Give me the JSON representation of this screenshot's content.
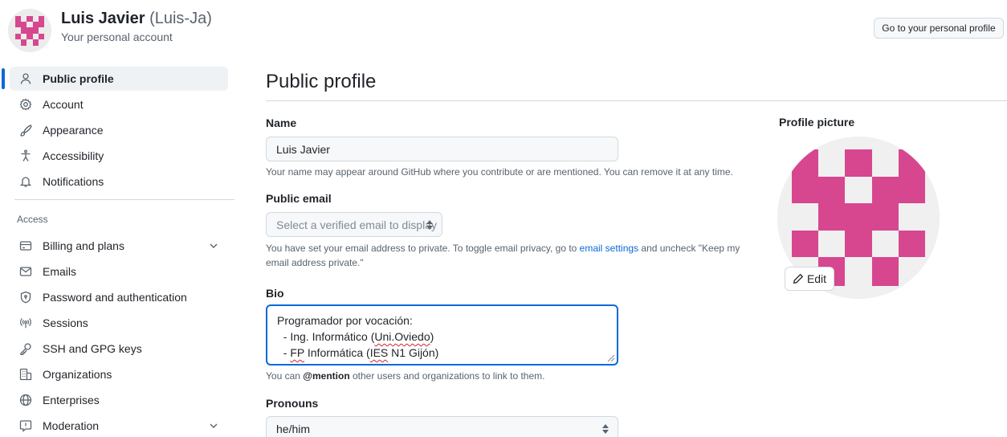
{
  "header": {
    "name": "Luis Javier",
    "handle": "(Luis-Ja)",
    "subtitle": "Your personal account",
    "go_button": "Go to your personal profile"
  },
  "sidebar": {
    "items": [
      {
        "label": "Public profile",
        "icon": "person-icon",
        "active": true
      },
      {
        "label": "Account",
        "icon": "gear-icon"
      },
      {
        "label": "Appearance",
        "icon": "paintbrush-icon"
      },
      {
        "label": "Accessibility",
        "icon": "accessibility-icon"
      },
      {
        "label": "Notifications",
        "icon": "bell-icon"
      }
    ],
    "access_heading": "Access",
    "access_items": [
      {
        "label": "Billing and plans",
        "icon": "credit-card-icon",
        "expandable": true
      },
      {
        "label": "Emails",
        "icon": "mail-icon"
      },
      {
        "label": "Password and authentication",
        "icon": "shield-lock-icon"
      },
      {
        "label": "Sessions",
        "icon": "broadcast-icon"
      },
      {
        "label": "SSH and GPG keys",
        "icon": "key-icon"
      },
      {
        "label": "Organizations",
        "icon": "organization-icon"
      },
      {
        "label": "Enterprises",
        "icon": "globe-icon"
      },
      {
        "label": "Moderation",
        "icon": "report-icon",
        "expandable": true
      }
    ]
  },
  "main": {
    "title": "Public profile",
    "name": {
      "label": "Name",
      "value": "Luis Javier",
      "help": "Your name may appear around GitHub where you contribute or are mentioned. You can remove it at any time."
    },
    "email": {
      "label": "Public email",
      "placeholder": "Select a verified email to display",
      "help_before": "You have set your email address to private. To toggle email privacy, go to",
      "help_link": "email settings",
      "help_after": "and uncheck \"Keep my",
      "help_line2": "email address private.\""
    },
    "bio": {
      "label": "Bio",
      "line1": "Programador por vocación:",
      "line2_pre": "  - Ing. Informático (",
      "line2_err": "Uni.Oviedo",
      "line2_post": ")",
      "line3_pre": "  - ",
      "line3_err1": "FP",
      "line3_mid": " Informática (",
      "line3_err2": "IES",
      "line3_post": " N1 Gijón)",
      "help_before": "You can",
      "help_mention": "@mention",
      "help_after": "other users and organizations to link to them."
    },
    "pronouns": {
      "label": "Pronouns",
      "value": "he/him"
    }
  },
  "profile_picture": {
    "label": "Profile picture",
    "edit_label": "Edit"
  },
  "colors": {
    "accent": "#0969da",
    "identicon": "#d6478f",
    "error_underline": "#d1242f"
  }
}
